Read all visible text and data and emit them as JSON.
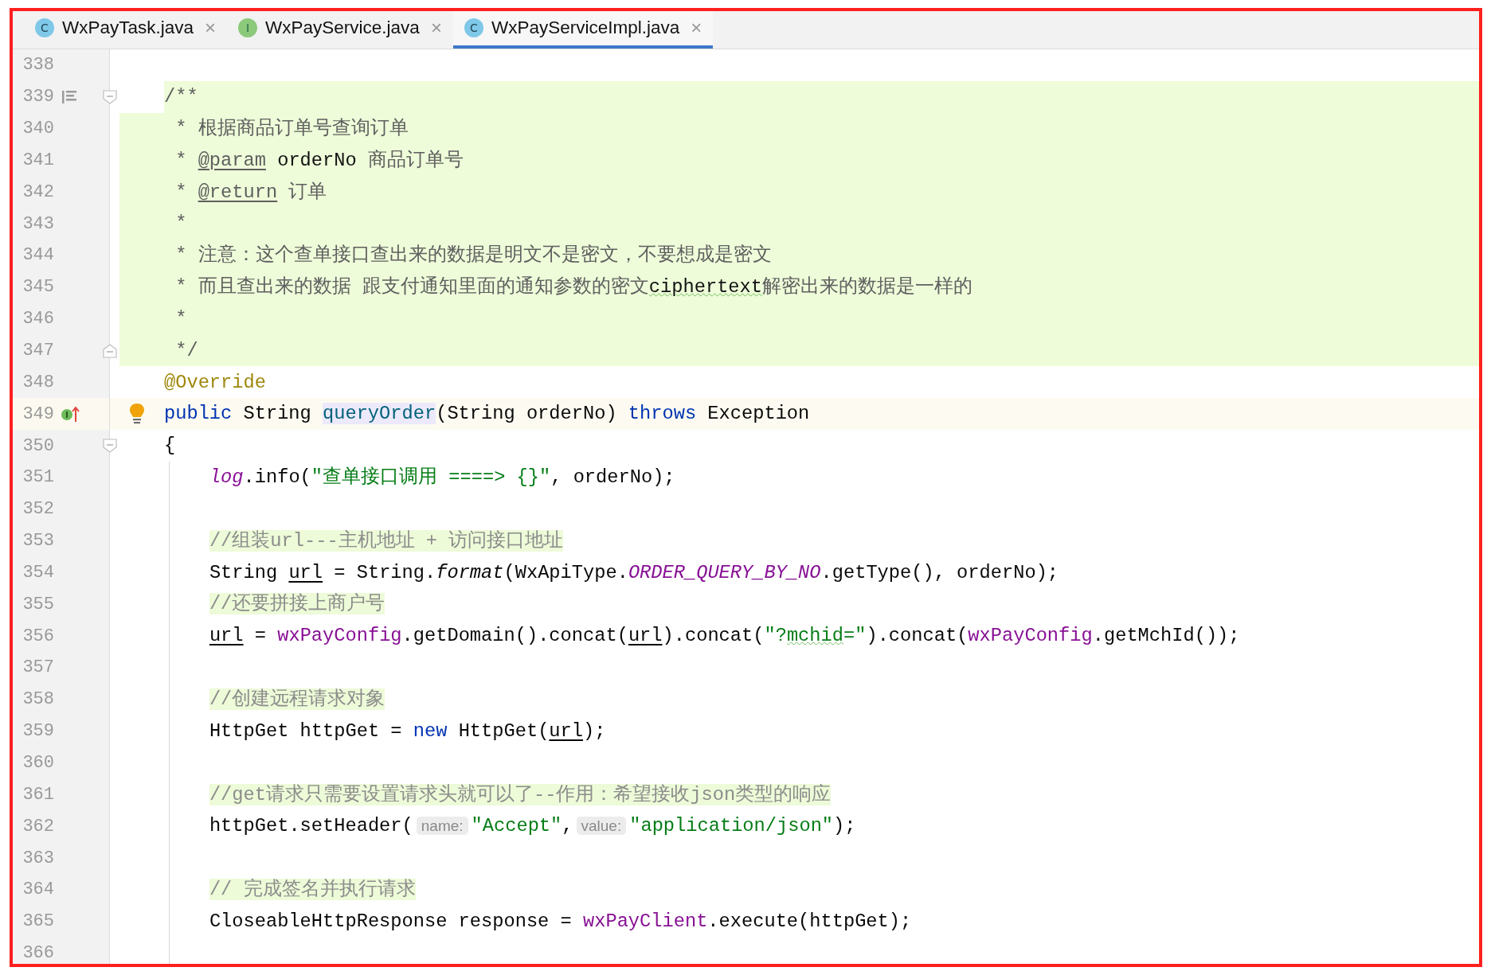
{
  "tabs": [
    {
      "label": "WxPayTask.java",
      "icon": "C",
      "kind": "class",
      "close": "×",
      "selected": false
    },
    {
      "label": "WxPayService.java",
      "icon": "I",
      "kind": "interface",
      "close": "×",
      "selected": false
    },
    {
      "label": "WxPayServiceImpl.java",
      "icon": "C",
      "kind": "class",
      "close": "×",
      "selected": true
    }
  ],
  "editor": {
    "lines": [
      {
        "number": "338",
        "doc": false,
        "current": false,
        "in_block": false,
        "bulb": false
      },
      {
        "number": "339",
        "doc": true,
        "current": false,
        "in_block": false,
        "bulb": false,
        "markers": [
          {
            "kind": "doc-toggle"
          },
          {
            "kind": "fold-start"
          }
        ],
        "tokens": [
          {
            "text": "/**",
            "kind": "doc"
          }
        ]
      },
      {
        "number": "340",
        "doc": true,
        "current": false,
        "in_block": false,
        "bulb": false,
        "tokens": [
          {
            "text": " * 根据商品订单号查询订单",
            "kind": "doc"
          }
        ]
      },
      {
        "number": "341",
        "doc": true,
        "current": false,
        "in_block": false,
        "bulb": false,
        "tokens": [
          {
            "text": " * ",
            "kind": "doc"
          },
          {
            "text": "@param",
            "kind": "doc_tag"
          },
          {
            "text": " orderNo",
            "kind": "doc_code"
          },
          {
            "text": " 商品订单号",
            "kind": "doc"
          }
        ]
      },
      {
        "number": "342",
        "doc": true,
        "current": false,
        "in_block": false,
        "bulb": false,
        "tokens": [
          {
            "text": " * ",
            "kind": "doc"
          },
          {
            "text": "@return",
            "kind": "doc_tag"
          },
          {
            "text": " 订单",
            "kind": "doc"
          }
        ]
      },
      {
        "number": "343",
        "doc": true,
        "current": false,
        "in_block": false,
        "bulb": false,
        "tokens": [
          {
            "text": " *",
            "kind": "doc"
          }
        ]
      },
      {
        "number": "344",
        "doc": true,
        "current": false,
        "in_block": false,
        "bulb": false,
        "tokens": [
          {
            "text": " * 注意：这个查单接口查出来的数据是明文不是密文，不要想成是密文",
            "kind": "doc"
          }
        ]
      },
      {
        "number": "345",
        "doc": true,
        "current": false,
        "in_block": false,
        "bulb": false,
        "tokens": [
          {
            "text": " * 而且查出来的数据 跟支付通知里面的通知参数的密文",
            "kind": "doc"
          },
          {
            "text": "ciphertext",
            "kind": "doc_code_typo"
          },
          {
            "text": "解密出来的数据是一样的",
            "kind": "doc"
          }
        ]
      },
      {
        "number": "346",
        "doc": true,
        "current": false,
        "in_block": false,
        "bulb": false,
        "tokens": [
          {
            "text": " *",
            "kind": "doc"
          }
        ]
      },
      {
        "number": "347",
        "doc": true,
        "current": false,
        "in_block": false,
        "bulb": false,
        "markers": [
          {
            "kind": "fold-end"
          }
        ],
        "tokens": [
          {
            "text": " */",
            "kind": "doc"
          }
        ]
      },
      {
        "number": "348",
        "doc": false,
        "current": false,
        "in_block": false,
        "bulb": false,
        "tokens": [
          {
            "text": "@Override",
            "kind": "annotation"
          }
        ]
      },
      {
        "number": "349",
        "doc": false,
        "current": true,
        "in_block": false,
        "bulb": true,
        "markers": [
          {
            "kind": "implements"
          }
        ],
        "tokens": [
          {
            "text": "public",
            "kind": "keyword"
          },
          {
            "text": " String ",
            "kind": "plain"
          },
          {
            "text": "queryOrder",
            "kind": "method_decl"
          },
          {
            "text": "(String orderNo) ",
            "kind": "plain"
          },
          {
            "text": "throws",
            "kind": "keyword"
          },
          {
            "text": " Exception",
            "kind": "plain"
          }
        ]
      },
      {
        "number": "350",
        "doc": false,
        "current": false,
        "in_block": false,
        "bulb": false,
        "markers": [
          {
            "kind": "fold-start"
          }
        ],
        "tokens": [
          {
            "text": "{",
            "kind": "plain"
          }
        ]
      },
      {
        "number": "351",
        "doc": false,
        "current": false,
        "in_block": true,
        "bulb": false,
        "tokens": [
          {
            "text": "log",
            "kind": "static_field"
          },
          {
            "text": ".info(",
            "kind": "plain"
          },
          {
            "text": "\"查单接口调用 ====> {}\"",
            "kind": "string"
          },
          {
            "text": ", orderNo);",
            "kind": "plain"
          }
        ]
      },
      {
        "number": "352",
        "doc": false,
        "current": false,
        "in_block": true,
        "bulb": false
      },
      {
        "number": "353",
        "doc": false,
        "current": false,
        "in_block": true,
        "bulb": false,
        "tokens": [
          {
            "text": "//组装url---主机地址 + 访问接口地址",
            "kind": "comment"
          }
        ]
      },
      {
        "number": "354",
        "doc": false,
        "current": false,
        "in_block": true,
        "bulb": false,
        "tokens": [
          {
            "text": "String ",
            "kind": "plain"
          },
          {
            "text": "url",
            "kind": "var_reassigned"
          },
          {
            "text": " = String.",
            "kind": "plain"
          },
          {
            "text": "format",
            "kind": "static_call"
          },
          {
            "text": "(WxApiType.",
            "kind": "plain"
          },
          {
            "text": "ORDER_QUERY_BY_NO",
            "kind": "static_field"
          },
          {
            "text": ".getType(), orderNo);",
            "kind": "plain"
          }
        ]
      },
      {
        "number": "355",
        "doc": false,
        "current": false,
        "in_block": true,
        "bulb": false,
        "tokens": [
          {
            "text": "//还要拼接上商户号",
            "kind": "comment"
          }
        ]
      },
      {
        "number": "356",
        "doc": false,
        "current": false,
        "in_block": true,
        "bulb": false,
        "tokens": [
          {
            "text": "url",
            "kind": "var_reassigned"
          },
          {
            "text": " = ",
            "kind": "plain"
          },
          {
            "text": "wxPayConfig",
            "kind": "field"
          },
          {
            "text": ".getDomain().concat(",
            "kind": "plain"
          },
          {
            "text": "url",
            "kind": "var_reassigned"
          },
          {
            "text": ").concat(",
            "kind": "plain"
          },
          {
            "text": "\"?",
            "kind": "string"
          },
          {
            "text": "mchid",
            "kind": "string_typo"
          },
          {
            "text": "=\"",
            "kind": "string"
          },
          {
            "text": ").concat(",
            "kind": "plain"
          },
          {
            "text": "wxPayConfig",
            "kind": "field"
          },
          {
            "text": ".getMchId());",
            "kind": "plain"
          }
        ]
      },
      {
        "number": "357",
        "doc": false,
        "current": false,
        "in_block": true,
        "bulb": false
      },
      {
        "number": "358",
        "doc": false,
        "current": false,
        "in_block": true,
        "bulb": false,
        "tokens": [
          {
            "text": "//创建远程请求对象",
            "kind": "comment"
          }
        ]
      },
      {
        "number": "359",
        "doc": false,
        "current": false,
        "in_block": true,
        "bulb": false,
        "tokens": [
          {
            "text": "HttpGet httpGet = ",
            "kind": "plain"
          },
          {
            "text": "new",
            "kind": "keyword"
          },
          {
            "text": " HttpGet(",
            "kind": "plain"
          },
          {
            "text": "url",
            "kind": "var_reassigned"
          },
          {
            "text": ");",
            "kind": "plain"
          }
        ]
      },
      {
        "number": "360",
        "doc": false,
        "current": false,
        "in_block": true,
        "bulb": false
      },
      {
        "number": "361",
        "doc": false,
        "current": false,
        "in_block": true,
        "bulb": false,
        "tokens": [
          {
            "text": "//get请求只需要设置请求头就可以了--作用：希望接收json类型的响应",
            "kind": "comment"
          }
        ]
      },
      {
        "number": "362",
        "doc": false,
        "current": false,
        "in_block": true,
        "bulb": false,
        "tokens": [
          {
            "text": "httpGet.setHeader(",
            "kind": "plain"
          },
          {
            "text": "name:",
            "kind": "hint"
          },
          {
            "text": "\"Accept\"",
            "kind": "string"
          },
          {
            "text": ",",
            "kind": "plain"
          },
          {
            "text": "value:",
            "kind": "hint"
          },
          {
            "text": "\"application/json\"",
            "kind": "string"
          },
          {
            "text": ");",
            "kind": "plain"
          }
        ]
      },
      {
        "number": "363",
        "doc": false,
        "current": false,
        "in_block": true,
        "bulb": false
      },
      {
        "number": "364",
        "doc": false,
        "current": false,
        "in_block": true,
        "bulb": false,
        "tokens": [
          {
            "text": "// 完成签名并执行请求",
            "kind": "comment"
          }
        ]
      },
      {
        "number": "365",
        "doc": false,
        "current": false,
        "in_block": true,
        "bulb": false,
        "tokens": [
          {
            "text": "CloseableHttpResponse response = ",
            "kind": "plain"
          },
          {
            "text": "wxPayClient",
            "kind": "field"
          },
          {
            "text": ".execute(httpGet);",
            "kind": "plain"
          }
        ]
      },
      {
        "number": "366",
        "doc": false,
        "current": false,
        "in_block": true,
        "bulb": false
      }
    ]
  }
}
